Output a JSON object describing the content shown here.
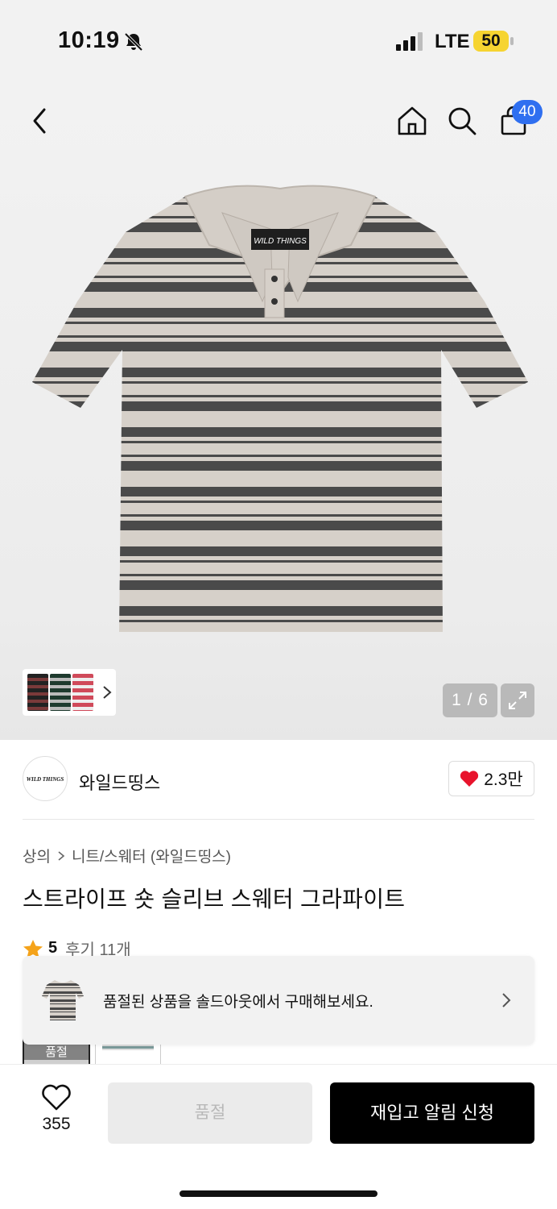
{
  "status_bar": {
    "time": "10:19",
    "network": "LTE",
    "battery": "50",
    "icons": [
      "bell-off-icon",
      "signal-icon"
    ]
  },
  "top_nav": {
    "icons": [
      "back-icon",
      "home-icon",
      "search-icon",
      "shopping-bag-icon"
    ],
    "cart_count": "40"
  },
  "gallery": {
    "counter": "1 / 6",
    "expand_icon": "expand-icon",
    "thumb_more_icon": "chevron-right-icon",
    "stripe_light": "#d6d0c9",
    "stripe_dark": "#4a4a4a"
  },
  "brand": {
    "name": "와일드띵스",
    "logo_text": "WILD THINGS",
    "likes": "2.3만",
    "like_icon": "heart-filled-icon",
    "like_color": "#e8132c"
  },
  "breadcrumb": [
    "상의",
    "니트/스웨터 (와일드띵스)"
  ],
  "product": {
    "title": "스트라이프 숏 슬리브 스웨터 그라파이트"
  },
  "rating": {
    "score": "5",
    "reviews": "후기 11개",
    "star_color": "#f5a31a"
  },
  "options": {
    "first_label": "품절"
  },
  "toast": {
    "text": "품절된 상품을 솔드아웃에서 구매해보세요."
  },
  "bottom_bar": {
    "wish_count": "355",
    "soldout_label": "품절",
    "restock_label": "재입고 알림 신청"
  }
}
